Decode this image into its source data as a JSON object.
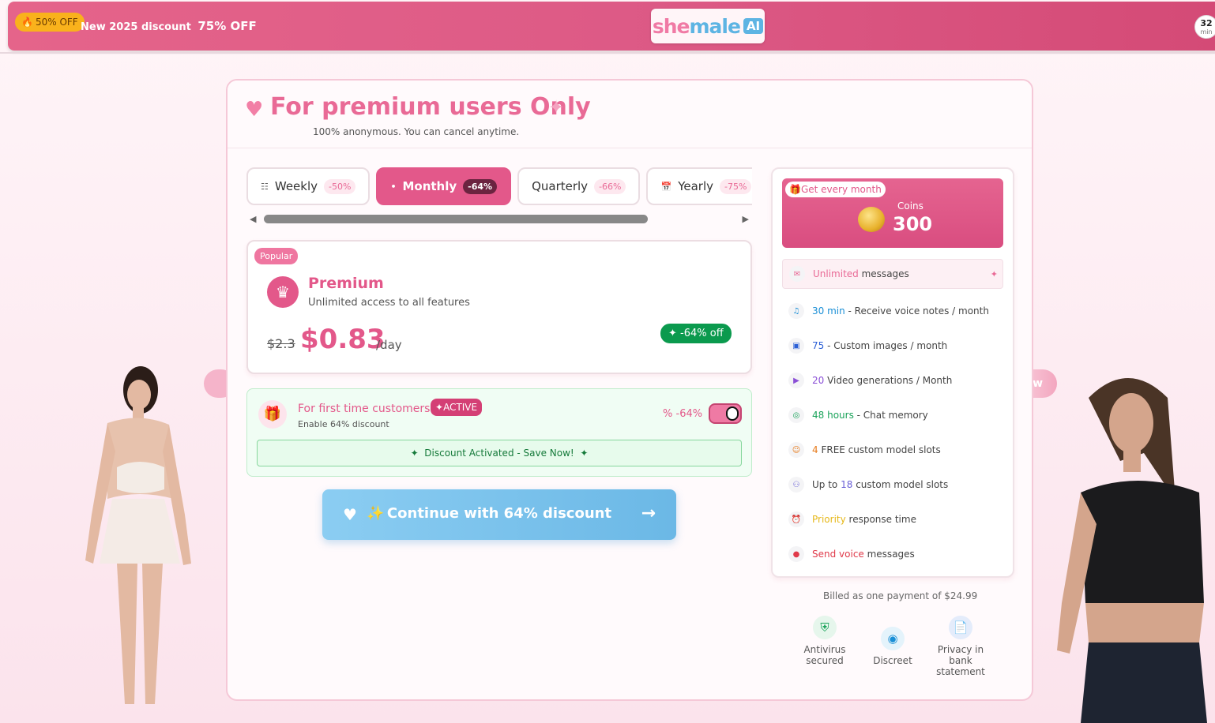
{
  "banner": {
    "badge_label": "50% OFF",
    "promo_text": "New 2025 discount",
    "promo_big": "75% OFF",
    "logo_she": "she",
    "logo_male": "male",
    "logo_ai": "AI",
    "timer_value": "32",
    "timer_unit": "min"
  },
  "header": {
    "title": "For premium users Only",
    "subtitle": "100% anonymous. You can cancel anytime."
  },
  "tabs": [
    {
      "label": "Weekly",
      "discount": "-50%"
    },
    {
      "label": "Monthly",
      "discount": "-64%",
      "active": true
    },
    {
      "label": "Quarterly",
      "discount": "-66%"
    },
    {
      "label": "Yearly",
      "discount": "-75%"
    }
  ],
  "plan": {
    "badge": "Popular",
    "name": "Premium",
    "description": "Unlimited access to all features",
    "old_price": "$2.3",
    "new_price": "$0.83",
    "period": "/day",
    "off_badge": "-64% off"
  },
  "first_time": {
    "title": "For first time customers",
    "active_label": "ACTIVE",
    "subtitle": "Enable 64% discount",
    "percent_label": "-64%",
    "activated_text": "Discount Activated - Save Now!",
    "toggle_on": true
  },
  "continue_button": {
    "label": "Continue with 64% discount"
  },
  "benefits": {
    "get_every_month": "Get every month",
    "coins_label": "Coins",
    "coins_value": "300",
    "features": [
      {
        "highlight": "Unlimited",
        "text": " messages",
        "color": "#e96a96",
        "icon": "chat-icon"
      },
      {
        "highlight": "30 min",
        "text": " - Receive voice notes / month",
        "color": "#1a8fd6",
        "icon": "speaker-icon"
      },
      {
        "highlight": "75",
        "text": " - Custom images / month",
        "color": "#2b5fd6",
        "icon": "image-icon"
      },
      {
        "highlight": "20",
        "text": " Video generations / Month",
        "color": "#8a4fd6",
        "icon": "video-icon"
      },
      {
        "highlight": "48 hours",
        "text": " - Chat memory",
        "color": "#1aa35a",
        "icon": "memory-icon"
      },
      {
        "highlight": "4",
        "text": " FREE custom model slots",
        "color": "#e67a1a",
        "icon": "users-icon"
      },
      {
        "highlight": "Up to",
        "text": " custom model slots",
        "number": "18",
        "color": "#6a5fd6",
        "icon": "group-icon"
      },
      {
        "highlight": "Priority",
        "text": " response time",
        "color": "#e6b81a",
        "icon": "clock-icon"
      },
      {
        "highlight": "Send voice",
        "text": " messages",
        "color": "#e03a4a",
        "icon": "mic-icon"
      }
    ]
  },
  "billing": {
    "text": "Billed as one payment of $24.99"
  },
  "trust": [
    {
      "label": "Antivirus secured",
      "icon": "shield-icon"
    },
    {
      "label": "Discreet",
      "icon": "eye-off-icon"
    },
    {
      "label": "Privacy in bank statement",
      "icon": "document-icon"
    }
  ],
  "colors": {
    "accent": "#e3588a",
    "banner": "#dd5a86",
    "button": "#6bb8e6",
    "success": "#0b9a4e"
  }
}
